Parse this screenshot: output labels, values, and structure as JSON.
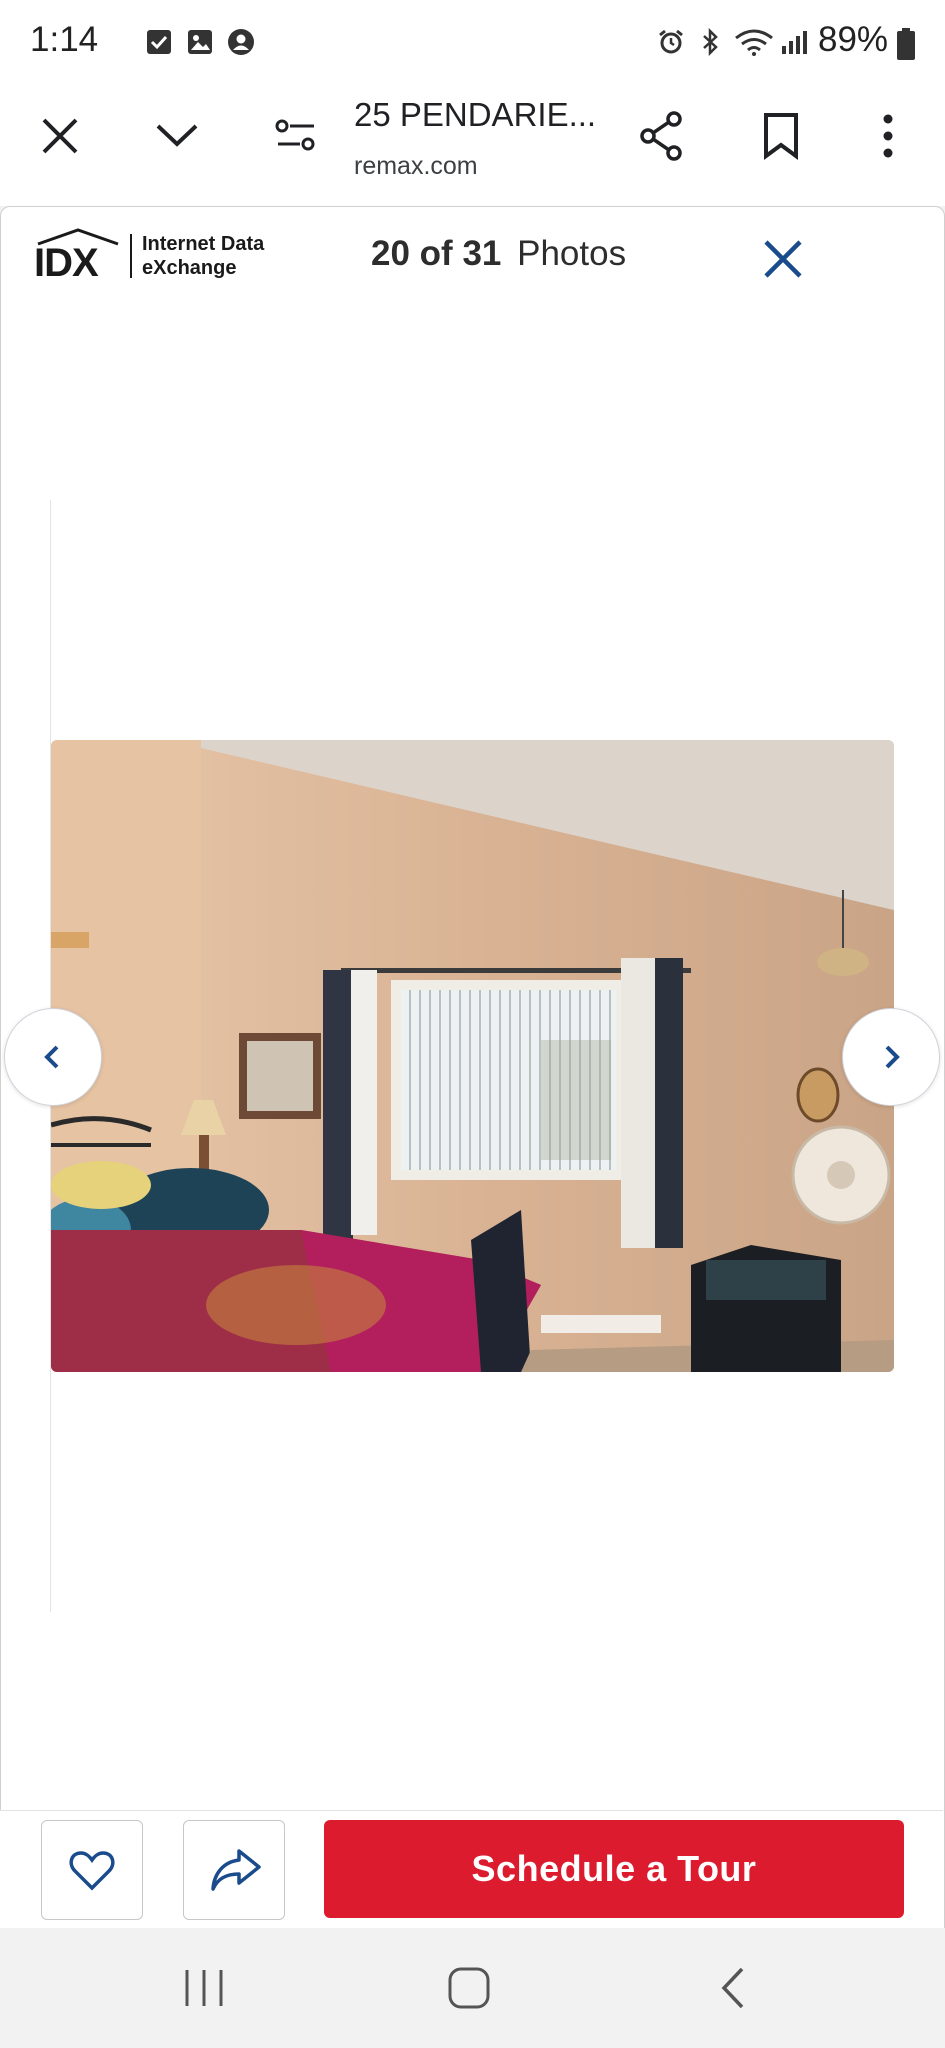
{
  "status_bar": {
    "time": "1:14",
    "battery": "89%",
    "icons": [
      "checkbox-notification-icon",
      "image-notification-icon",
      "account-notification-icon",
      "alarm-icon",
      "bluetooth-icon",
      "wifi-icon",
      "signal-icon",
      "battery-icon"
    ]
  },
  "browser": {
    "page_title": "25 PENDARIE...",
    "domain": "remax.com",
    "icons": [
      "close-icon",
      "chevron-down-icon",
      "page-controls-icon",
      "share-icon",
      "bookmark-icon",
      "more-vert-icon"
    ]
  },
  "gallery": {
    "logo": {
      "mark": "IDX",
      "line1": "Internet Data",
      "line2": "eXchange"
    },
    "current": "20",
    "of_word": "of",
    "total": "31",
    "label": "Photos",
    "photo_alt": "Bedroom with bed, window with vertical blinds and curtains, chair",
    "accent_color": "#1a4b8c"
  },
  "actions": {
    "favorite_icon": "heart-icon",
    "share_icon": "share-arrow-icon",
    "schedule_label": "Schedule a Tour",
    "schedule_color": "#dc1c2e"
  },
  "system_nav": {
    "icons": [
      "recent-apps-icon",
      "home-icon",
      "back-icon"
    ]
  }
}
